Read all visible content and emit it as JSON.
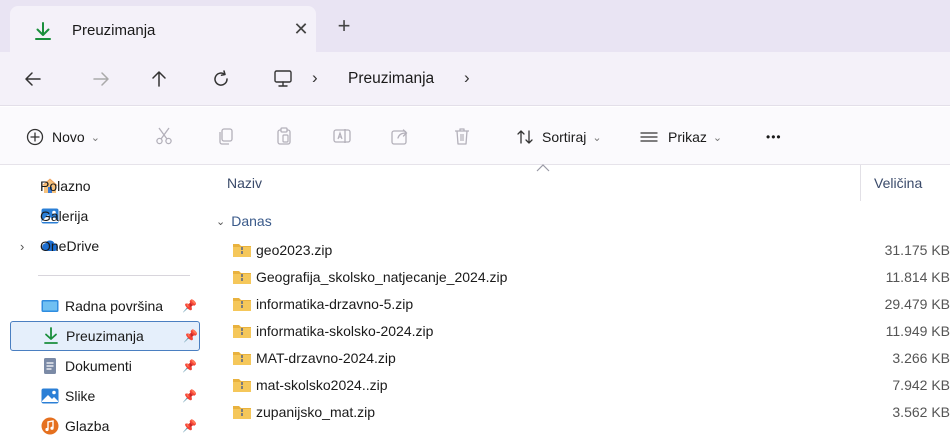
{
  "tab": {
    "title": "Preuzimanja",
    "close": "✕",
    "new_tab": "+"
  },
  "address": {
    "folder": "Preuzimanja",
    "sep1": "›",
    "sep2": "›"
  },
  "toolbar": {
    "new_label": "Novo",
    "new_caret": "⌄",
    "sort_label": "Sortiraj",
    "sort_caret": "⌄",
    "view_label": "Prikaz",
    "view_caret": "⌄",
    "more": "•••"
  },
  "sidebar": {
    "items": [
      {
        "label": "Polazno",
        "icon": "home-icon"
      },
      {
        "label": "Galerija",
        "icon": "gallery-icon"
      },
      {
        "label": "OneDrive",
        "icon": "cloud-icon"
      },
      {
        "label": "Radna površina",
        "icon": "desktop-icon"
      },
      {
        "label": "Preuzimanja",
        "icon": "download-icon"
      },
      {
        "label": "Dokumenti",
        "icon": "document-icon"
      },
      {
        "label": "Slike",
        "icon": "pictures-icon"
      },
      {
        "label": "Glazba",
        "icon": "music-icon"
      }
    ]
  },
  "columns": {
    "name": "Naziv",
    "size": "Veličina"
  },
  "group": {
    "label": "Danas"
  },
  "files": [
    {
      "name": "geo2023.zip",
      "size": "31.175 KB"
    },
    {
      "name": "Geografija_skolsko_natjecanje_2024.zip",
      "size": "11.814 KB"
    },
    {
      "name": "informatika-drzavno-5.zip",
      "size": "29.479 KB"
    },
    {
      "name": "informatika-skolsko-2024.zip",
      "size": "11.949 KB"
    },
    {
      "name": "MAT-drzavno-2024.zip",
      "size": "3.266 KB"
    },
    {
      "name": "mat-skolsko2024..zip",
      "size": "7.942 KB"
    },
    {
      "name": "zupanijsko_mat.zip",
      "size": "3.562 KB"
    }
  ],
  "colors": {
    "accent": "#2b6cc4",
    "download_green": "#1a8f3c",
    "tabbar_bg": "#e9e4f3"
  }
}
